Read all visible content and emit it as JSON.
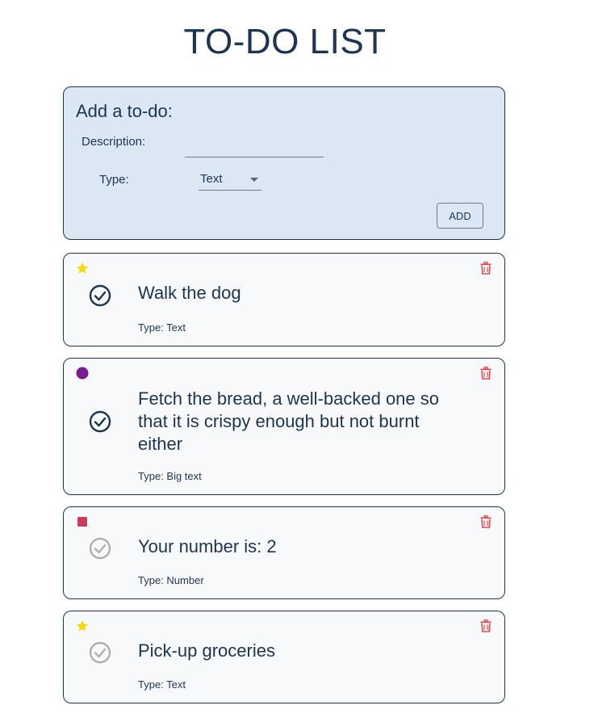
{
  "page": {
    "title": "TO-DO LIST"
  },
  "add_form": {
    "heading": "Add a to-do:",
    "description_label": "Description:",
    "description_value": "",
    "type_label": "Type:",
    "type_selected": "Text",
    "add_button": "ADD"
  },
  "todos": [
    {
      "priority_icon": "star-icon",
      "priority_color": "#f5d90a",
      "text": "Walk the dog",
      "type_text": "Type: Text",
      "completed": true
    },
    {
      "priority_icon": "circle-icon",
      "priority_color": "#7b1c8e",
      "text": "Fetch the bread, a well-backed one so that it is crispy enough but not burnt either",
      "type_text": "Type: Big text",
      "completed": true
    },
    {
      "priority_icon": "square-icon",
      "priority_color": "#c93d5c",
      "text": "Your number is: 2",
      "type_text": "Type: Number",
      "completed": false
    },
    {
      "priority_icon": "star-icon",
      "priority_color": "#f5d90a",
      "text": "Pick-up groceries",
      "type_text": "Type: Text",
      "completed": false
    }
  ],
  "colors": {
    "primary": "#1c3553",
    "form_bg": "#dbe7f3",
    "card_bg": "#f7f9fb",
    "delete": "#e5484d",
    "check_done": "#1c3553",
    "check_pending": "#b0b0b0"
  }
}
